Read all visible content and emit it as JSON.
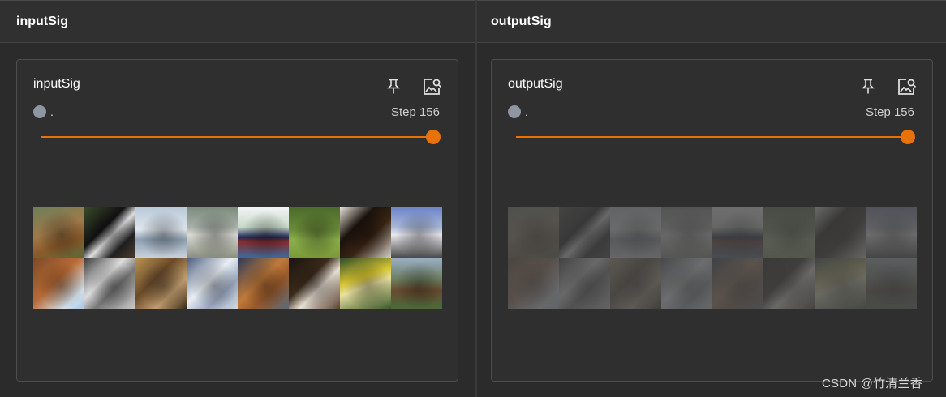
{
  "panels": [
    {
      "header": "inputSig",
      "card_title": "inputSig",
      "run_name": ".",
      "step_text": "Step 156",
      "slider_value_fraction": 1.0,
      "faded": false
    },
    {
      "header": "outputSig",
      "card_title": "outputSig",
      "run_name": ".",
      "step_text": "Step 156",
      "slider_value_fraction": 1.0,
      "faded": true
    }
  ],
  "icons": {
    "pin": "pin-icon",
    "image_search": "image-search-icon"
  },
  "colors": {
    "accent": "#e8710a",
    "run_dot": "#8e96a2"
  },
  "image_tiles": [
    "linear-gradient(160deg,#6b7f5a 0%,#a07a4a 45%,#8a5a2a 70%,#5a6a3a 100%)",
    "linear-gradient(135deg,#3a4a2a 0%,#111 40%,#ddd 55%,#222 75%,#4a3a2a 100%)",
    "linear-gradient(180deg,#b8c8d8 0%,#dfe6ee 45%,#8fa0b2 65%,#c8d2dc 100%)",
    "linear-gradient(180deg,#7a8a7a 0%,#a8b0a8 40%,#d8dad2 55%,#8a8e80 100%)",
    "linear-gradient(180deg,#f4f6f8 0%,#c8d8c8 40%,#1e2a5a 60%,#8a2a2a 68%,#3a6a9a 100%)",
    "linear-gradient(180deg,#4a6a2a 0%,#6a8a3a 45%,#8ab04a 65%,#7a9a3a 100%)",
    "linear-gradient(135deg,#e8e4dc 0%,#1a120c 35%,#3a2414 60%,#d0ccc4 100%)",
    "linear-gradient(180deg,#6a82c8 0%,#a8b8d8 40%,#e8e8ee 55%,#4a4a4a 100%)",
    "linear-gradient(135deg,#7a4a2a 0%,#b86a34 45%,#d4e4f0 80%,#a8c4e0 100%)",
    "linear-gradient(135deg,#3a3a3a 0%,#ddd 40%,#777 60%,#c8c8c8 100%)",
    "linear-gradient(135deg,#b89450 0%,#6a4a2a 40%,#c4a070 70%,#3a2a1a 100%)",
    "linear-gradient(135deg,#4a5a7a 0%,#e8eef4 45%,#9aa8c0 70%,#d0d8e0 100%)",
    "linear-gradient(135deg,#2a3a5a 0%,#c07a3a 45%,#9a5a2a 65%,#5a6a7a 100%)",
    "linear-gradient(135deg,#1a140e 0%,#3a2a1a 40%,#e8e0d4 60%,#5a4030 100%)",
    "linear-gradient(160deg,#2a4a2a 0%,#d8c430 40%,#e8e0a0 55%,#3a5a2a 100%)",
    "linear-gradient(180deg,#9ab0c8 0%,#6a7a5a 45%,#6a4a30 65%,#4a6a3a 100%)"
  ],
  "watermark": "CSDN @竹清兰香"
}
